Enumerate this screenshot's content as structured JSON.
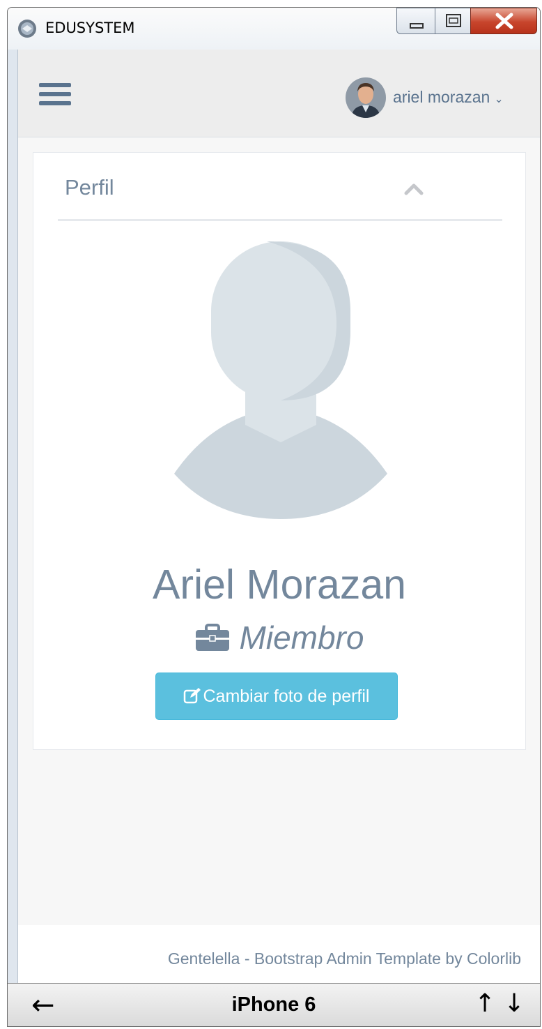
{
  "window": {
    "title": "EDUSYSTEM"
  },
  "topnav": {
    "user_name": "ariel morazan",
    "caret": "⌄"
  },
  "profile_panel": {
    "title": "Perfil",
    "name": "Ariel Morazan",
    "role": "Miembro",
    "change_photo_label": "Cambiar foto de perfil"
  },
  "footer": {
    "text": "Gentelella - Bootstrap Admin Template by Colorlib"
  },
  "device_bar": {
    "back": "←",
    "device": "iPhone 6",
    "up": "↑",
    "down": "↓"
  },
  "colors": {
    "text_muted": "#73879c",
    "nav_icon": "#5a738e",
    "button_info": "#5bc0de",
    "panel_bg": "#ffffff",
    "page_bg": "#f7f7f7"
  },
  "icons": [
    "app-logo-icon",
    "minimize-icon",
    "maximize-icon",
    "close-icon",
    "hamburger-menu-icon",
    "chevron-up-icon",
    "briefcase-icon",
    "edit-icon",
    "default-avatar-icon"
  ]
}
